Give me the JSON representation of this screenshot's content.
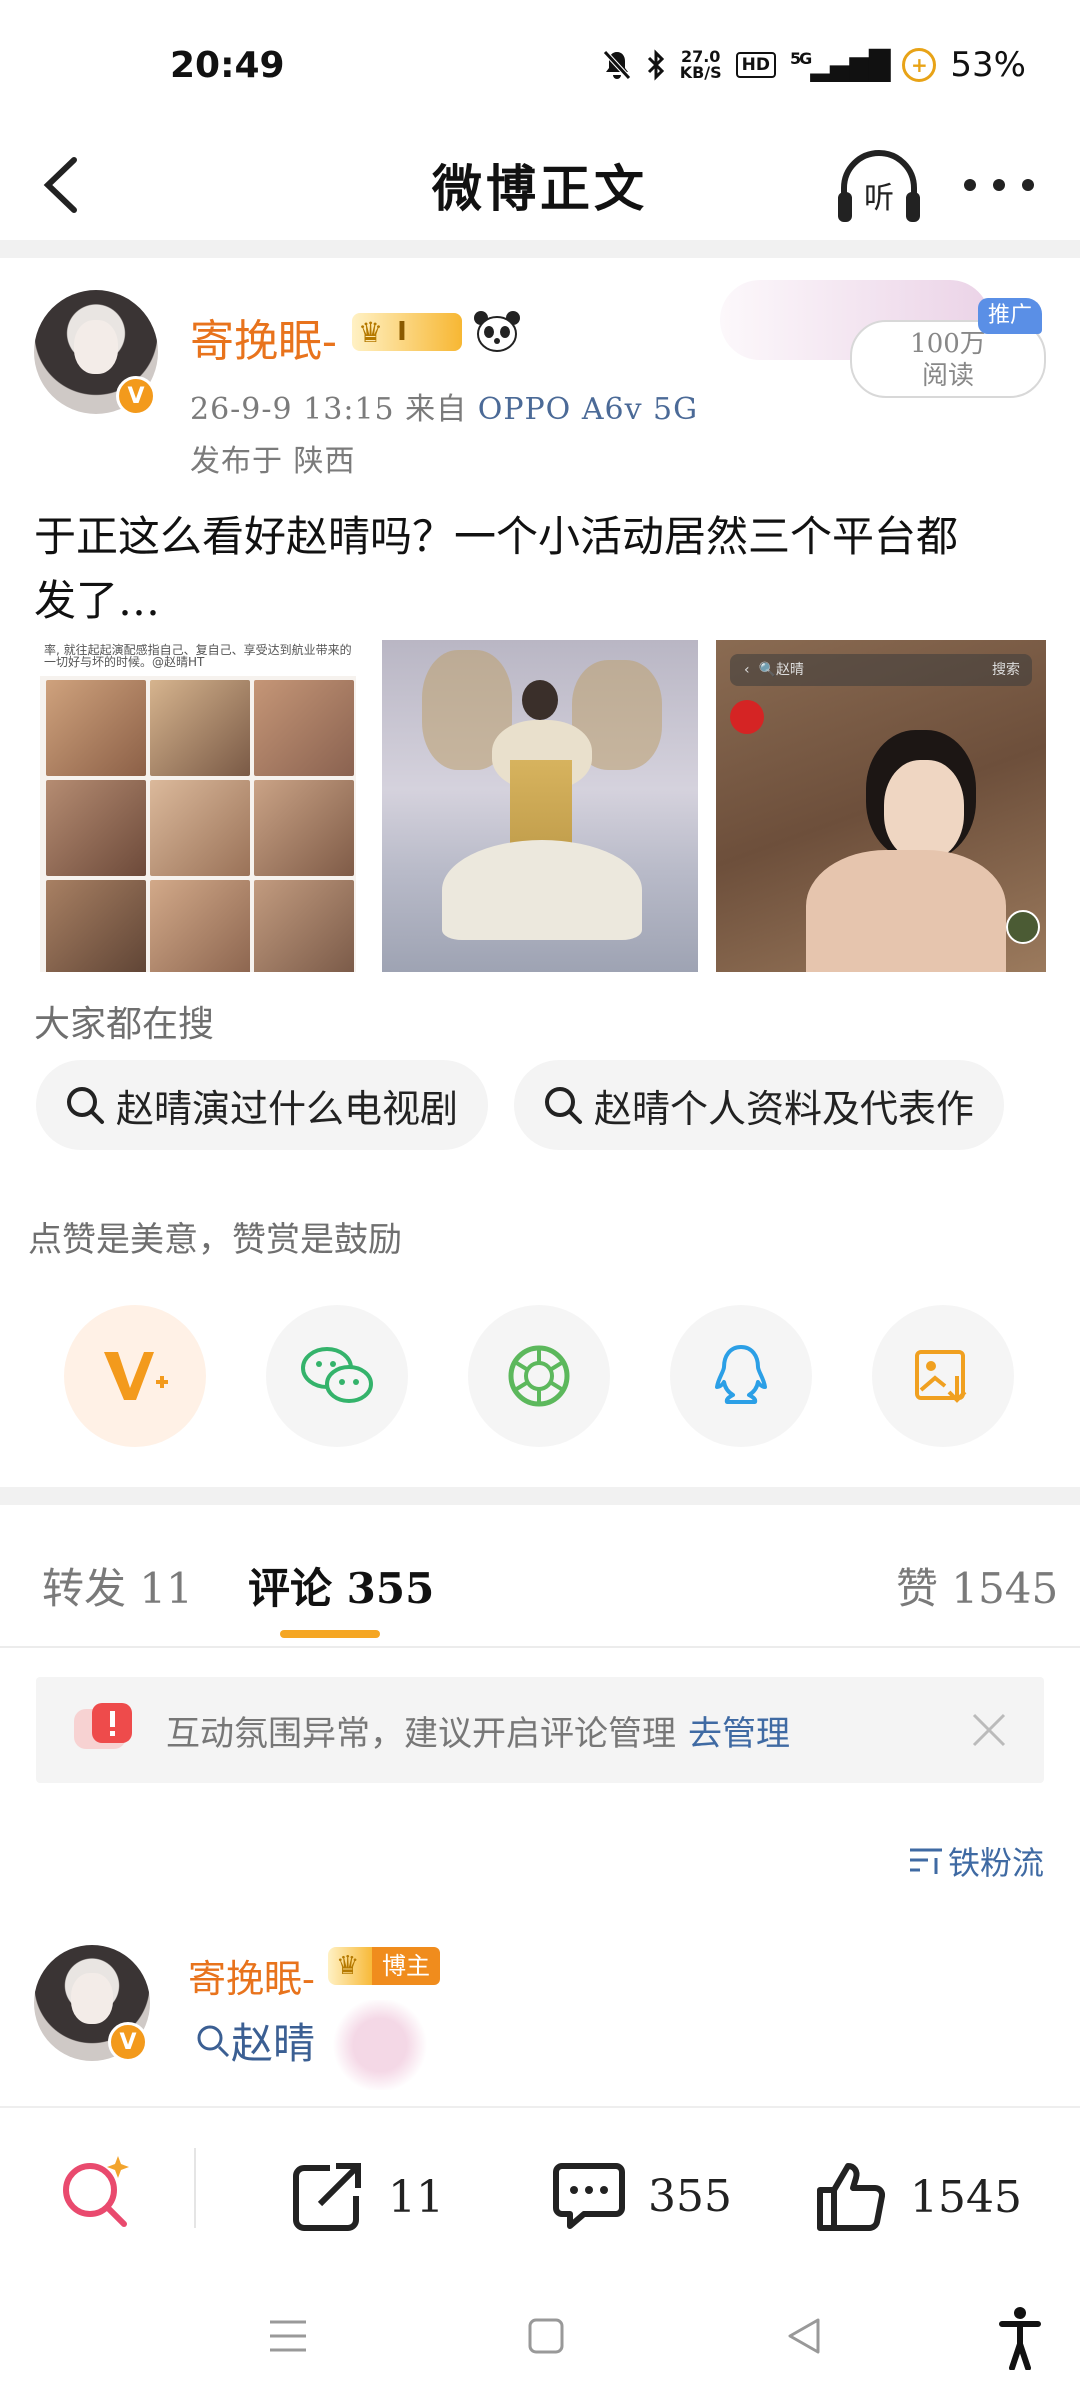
{
  "status_bar": {
    "time": "20:49",
    "net_speed_top": "27.0",
    "net_speed_bottom": "KB/S",
    "hd": "HD",
    "signal": "5G",
    "battery": "53%"
  },
  "header": {
    "title": "微博正文",
    "listen_label": "听"
  },
  "post": {
    "author": "寄挽眠-",
    "level": "I",
    "date": "26-9-9 13:15",
    "from_label": "来自",
    "device": "OPPO A6v 5G",
    "location": "发布于 陕西",
    "text_line1": "于正这么看好赵晴吗？一个小活动居然三个平台都",
    "text_line2": "发了…",
    "reads": "100万",
    "reads_label": "阅读",
    "ad_tag": "推广",
    "grid_caption": "率, 就往起起演配感指自己、复自己、享受达到航业带来的一切好与坏的时候。@赵晴HT",
    "portrait_search": "赵晴",
    "portrait_search_button": "搜索"
  },
  "searches": {
    "label": "大家都在搜",
    "items": [
      "赵晴演过什么电视剧",
      "赵晴个人资料及代表作"
    ]
  },
  "share": {
    "label": "点赞是美意，赞赏是鼓励",
    "icons": [
      "v-plus-icon",
      "wechat-icon",
      "moments-icon",
      "qq-icon",
      "save-image-icon"
    ]
  },
  "tabs": {
    "repost": "转发 11",
    "comments": "评论 355",
    "likes": "赞 1545"
  },
  "notice": {
    "text": "互动氛围异常，建议开启评论管理",
    "link": "去管理"
  },
  "filter": {
    "label": "铁粉流"
  },
  "comment": {
    "author": "寄挽眠-",
    "badge": "博主",
    "text": "赵晴"
  },
  "actions": {
    "repost_count": "11",
    "comment_count": "355",
    "like_count": "1545"
  }
}
